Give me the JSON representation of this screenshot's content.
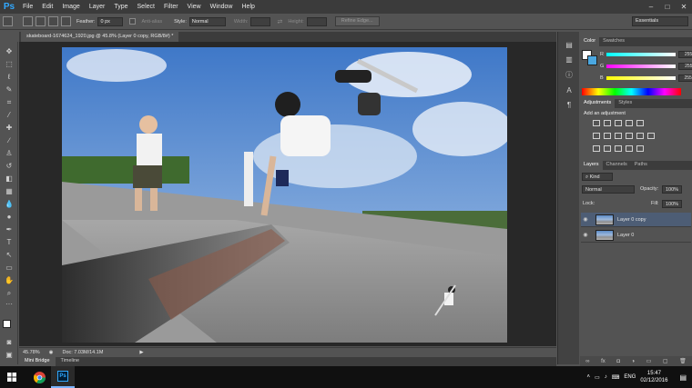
{
  "app": {
    "logo": "Ps"
  },
  "menu": [
    "File",
    "Edit",
    "Image",
    "Layer",
    "Type",
    "Select",
    "Filter",
    "View",
    "Window",
    "Help"
  ],
  "window_controls": [
    "–",
    "□",
    "✕"
  ],
  "options_bar": {
    "feather_label": "Feather:",
    "feather_value": "0 px",
    "antialias_label": "Anti-alias",
    "style_label": "Style:",
    "style_value": "Normal",
    "width_label": "Width:",
    "height_label": "Height:",
    "refine_edge_label": "Refine Edge...",
    "workspace_value": "Essentials"
  },
  "document": {
    "tab_title": "skateboard-1674624_1920.jpg @ 45.8% (Layer 0 copy, RGB/8#) *",
    "zoom": "45.78%",
    "doc_size": "Doc: 7.03M/14.1M"
  },
  "bottom_tabs": [
    "Mini Bridge",
    "Timeline"
  ],
  "color_panel": {
    "tabs": [
      "Color",
      "Swatches"
    ],
    "channels": [
      {
        "label": "R",
        "value": "255",
        "gradient": "linear-gradient(90deg,#00ffff,#ffffff)"
      },
      {
        "label": "G",
        "value": "255",
        "gradient": "linear-gradient(90deg,#ff00ff,#ffffff)"
      },
      {
        "label": "B",
        "value": "255",
        "gradient": "linear-gradient(90deg,#ffff00,#ffffff)"
      }
    ]
  },
  "adjustments_panel": {
    "tabs": [
      "Adjustments",
      "Styles"
    ],
    "header": "Add an adjustment"
  },
  "layers_panel": {
    "tabs": [
      "Layers",
      "Channels",
      "Paths"
    ],
    "kind_label": "Kind",
    "blend_mode": "Normal",
    "opacity_label": "Opacity:",
    "opacity_value": "100%",
    "lock_label": "Lock:",
    "fill_label": "Fill:",
    "fill_value": "100%",
    "layers": [
      {
        "name": "Layer 0 copy",
        "selected": true
      },
      {
        "name": "Layer 0",
        "selected": false
      }
    ]
  },
  "taskbar": {
    "language": "ENG",
    "time": "15:47",
    "date": "02/12/2016"
  },
  "colors": {
    "accent": "#31a8ff",
    "selection": "#4d5d75",
    "chrome_dark": "#3c3c3c",
    "chrome": "#535353"
  }
}
